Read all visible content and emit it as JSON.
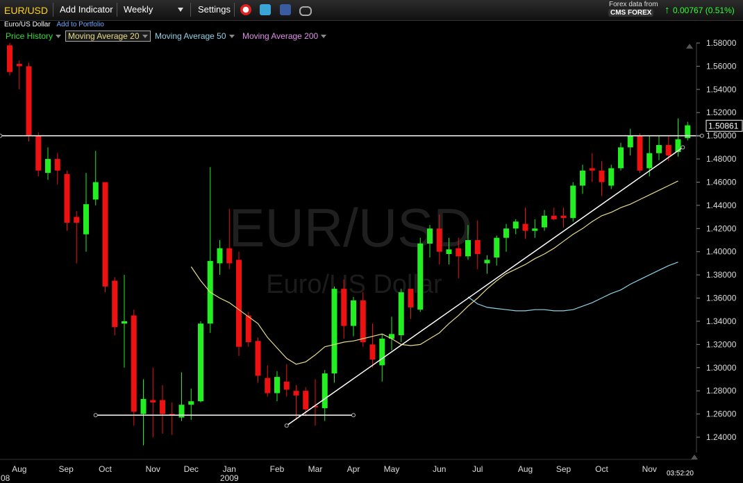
{
  "toolbar": {
    "symbol": "EUR/USD",
    "add_indicator": "Add Indicator",
    "interval": "Weekly",
    "settings": "Settings",
    "alarm_icon": "alarm-clock-icon",
    "twitter_icon": "twitter-icon",
    "facebook_icon": "facebook-icon",
    "link_icon": "link-icon"
  },
  "subheader": {
    "name": "Euro/US Dollar",
    "add_portfolio": "Add to Portfolio"
  },
  "indicators": [
    {
      "label": "Price History",
      "color": "#33dd33"
    },
    {
      "label": "Moving Average 20",
      "color": "#e8dc8a"
    },
    {
      "label": "Moving Average 50",
      "color": "#8fd3e8"
    },
    {
      "label": "Moving Average 200",
      "color": "#e090e8"
    }
  ],
  "data_source": {
    "line1": "Forex data from",
    "line2": "CMS FOREX"
  },
  "change": {
    "text": "0.00767 (0.51%)",
    "color": "#33ff33"
  },
  "timestamp": "03:52:20",
  "chart_data": {
    "type": "candlestick",
    "title": "EUR/USD",
    "subtitle": "Euro/US Dollar",
    "colors": {
      "up": "#22ee22",
      "down": "#ee1111",
      "ma20": "#e8dc8a",
      "ma50": "#8fd3e8",
      "trend": "#ffffff"
    },
    "ylim": [
      1.225,
      1.59
    ],
    "yticks": [
      "1.58000",
      "1.56000",
      "1.54000",
      "1.52000",
      "1.50000",
      "1.48000",
      "1.46000",
      "1.44000",
      "1.42000",
      "1.40000",
      "1.38000",
      "1.36000",
      "1.34000",
      "1.32000",
      "1.30000",
      "1.28000",
      "1.26000",
      "1.24000"
    ],
    "ytick_values": [
      1.58,
      1.56,
      1.54,
      1.52,
      1.5,
      1.48,
      1.46,
      1.44,
      1.42,
      1.4,
      1.38,
      1.36,
      1.34,
      1.32,
      1.3,
      1.28,
      1.26,
      1.24
    ],
    "last_price": "1.50861",
    "last_value": 1.50861,
    "xlabels": [
      {
        "text": "Aug",
        "week": 1
      },
      {
        "text": "Sep",
        "week": 5.9
      },
      {
        "text": "Oct",
        "week": 10
      },
      {
        "text": "Nov",
        "week": 15
      },
      {
        "text": "Dec",
        "week": 19
      },
      {
        "text": "Jan",
        "week": 23
      },
      {
        "text": "Feb",
        "week": 28
      },
      {
        "text": "Mar",
        "week": 32
      },
      {
        "text": "Apr",
        "week": 36
      },
      {
        "text": "May",
        "week": 40
      },
      {
        "text": "Jun",
        "week": 45
      },
      {
        "text": "Jul",
        "week": 49
      },
      {
        "text": "Aug",
        "week": 54
      },
      {
        "text": "Sep",
        "week": 58
      },
      {
        "text": "Oct",
        "week": 62
      },
      {
        "text": "Nov",
        "week": 67
      }
    ],
    "xlabels_year": [
      {
        "text": "08",
        "week": 0
      },
      {
        "text": "2009",
        "week": 23
      }
    ],
    "candles": [
      {
        "o": 1.578,
        "h": 1.58,
        "l": 1.552,
        "c": 1.555
      },
      {
        "o": 1.562,
        "h": 1.565,
        "l": 1.54,
        "c": 1.56
      },
      {
        "o": 1.56,
        "h": 1.563,
        "l": 1.495,
        "c": 1.5
      },
      {
        "o": 1.5,
        "h": 1.503,
        "l": 1.465,
        "c": 1.47
      },
      {
        "o": 1.468,
        "h": 1.49,
        "l": 1.462,
        "c": 1.48
      },
      {
        "o": 1.48,
        "h": 1.485,
        "l": 1.458,
        "c": 1.47
      },
      {
        "o": 1.467,
        "h": 1.47,
        "l": 1.418,
        "c": 1.425
      },
      {
        "o": 1.43,
        "h": 1.435,
        "l": 1.39,
        "c": 1.425
      },
      {
        "o": 1.415,
        "h": 1.468,
        "l": 1.4,
        "c": 1.441
      },
      {
        "o": 1.445,
        "h": 1.487,
        "l": 1.44,
        "c": 1.46
      },
      {
        "o": 1.46,
        "h": 1.46,
        "l": 1.365,
        "c": 1.37
      },
      {
        "o": 1.375,
        "h": 1.378,
        "l": 1.328,
        "c": 1.335
      },
      {
        "o": 1.338,
        "h": 1.38,
        "l": 1.3,
        "c": 1.34
      },
      {
        "o": 1.345,
        "h": 1.35,
        "l": 1.25,
        "c": 1.262
      },
      {
        "o": 1.26,
        "h": 1.29,
        "l": 1.233,
        "c": 1.273
      },
      {
        "o": 1.272,
        "h": 1.3,
        "l": 1.24,
        "c": 1.27
      },
      {
        "o": 1.272,
        "h": 1.285,
        "l": 1.243,
        "c": 1.26
      },
      {
        "o": 1.26,
        "h": 1.27,
        "l": 1.242,
        "c": 1.259
      },
      {
        "o": 1.257,
        "h": 1.296,
        "l": 1.254,
        "c": 1.268
      },
      {
        "o": 1.268,
        "h": 1.282,
        "l": 1.255,
        "c": 1.271
      },
      {
        "o": 1.271,
        "h": 1.34,
        "l": 1.27,
        "c": 1.338
      },
      {
        "o": 1.338,
        "h": 1.473,
        "l": 1.33,
        "c": 1.392
      },
      {
        "o": 1.39,
        "h": 1.41,
        "l": 1.38,
        "c": 1.403
      },
      {
        "o": 1.403,
        "h": 1.437,
        "l": 1.385,
        "c": 1.39
      },
      {
        "o": 1.393,
        "h": 1.4,
        "l": 1.31,
        "c": 1.318
      },
      {
        "o": 1.345,
        "h": 1.348,
        "l": 1.318,
        "c": 1.322
      },
      {
        "o": 1.323,
        "h": 1.326,
        "l": 1.287,
        "c": 1.293
      },
      {
        "o": 1.291,
        "h": 1.302,
        "l": 1.275,
        "c": 1.278
      },
      {
        "o": 1.278,
        "h": 1.297,
        "l": 1.271,
        "c": 1.292
      },
      {
        "o": 1.288,
        "h": 1.303,
        "l": 1.275,
        "c": 1.281
      },
      {
        "o": 1.28,
        "h": 1.285,
        "l": 1.255,
        "c": 1.276
      },
      {
        "o": 1.28,
        "h": 1.283,
        "l": 1.258,
        "c": 1.264
      },
      {
        "o": 1.267,
        "h": 1.29,
        "l": 1.25,
        "c": 1.266
      },
      {
        "o": 1.265,
        "h": 1.298,
        "l": 1.254,
        "c": 1.295
      },
      {
        "o": 1.295,
        "h": 1.37,
        "l": 1.287,
        "c": 1.368
      },
      {
        "o": 1.368,
        "h": 1.376,
        "l": 1.325,
        "c": 1.336
      },
      {
        "o": 1.336,
        "h": 1.361,
        "l": 1.327,
        "c": 1.358
      },
      {
        "o": 1.358,
        "h": 1.365,
        "l": 1.318,
        "c": 1.322
      },
      {
        "o": 1.32,
        "h": 1.338,
        "l": 1.3,
        "c": 1.307
      },
      {
        "o": 1.302,
        "h": 1.329,
        "l": 1.288,
        "c": 1.325
      },
      {
        "o": 1.325,
        "h": 1.344,
        "l": 1.315,
        "c": 1.329
      },
      {
        "o": 1.328,
        "h": 1.368,
        "l": 1.322,
        "c": 1.365
      },
      {
        "o": 1.368,
        "h": 1.365,
        "l": 1.342,
        "c": 1.352
      },
      {
        "o": 1.35,
        "h": 1.412,
        "l": 1.348,
        "c": 1.407
      },
      {
        "o": 1.407,
        "h": 1.423,
        "l": 1.395,
        "c": 1.42
      },
      {
        "o": 1.42,
        "h": 1.432,
        "l": 1.389,
        "c": 1.4
      },
      {
        "o": 1.398,
        "h": 1.412,
        "l": 1.389,
        "c": 1.402
      },
      {
        "o": 1.403,
        "h": 1.412,
        "l": 1.377,
        "c": 1.396
      },
      {
        "o": 1.396,
        "h": 1.423,
        "l": 1.393,
        "c": 1.41
      },
      {
        "o": 1.41,
        "h": 1.427,
        "l": 1.385,
        "c": 1.398
      },
      {
        "o": 1.39,
        "h": 1.397,
        "l": 1.381,
        "c": 1.393
      },
      {
        "o": 1.395,
        "h": 1.414,
        "l": 1.388,
        "c": 1.412
      },
      {
        "o": 1.412,
        "h": 1.424,
        "l": 1.4,
        "c": 1.42
      },
      {
        "o": 1.42,
        "h": 1.428,
        "l": 1.415,
        "c": 1.426
      },
      {
        "o": 1.424,
        "h": 1.438,
        "l": 1.411,
        "c": 1.418
      },
      {
        "o": 1.418,
        "h": 1.428,
        "l": 1.412,
        "c": 1.42
      },
      {
        "o": 1.421,
        "h": 1.436,
        "l": 1.418,
        "c": 1.431
      },
      {
        "o": 1.431,
        "h": 1.438,
        "l": 1.427,
        "c": 1.428
      },
      {
        "o": 1.431,
        "h": 1.438,
        "l": 1.421,
        "c": 1.429
      },
      {
        "o": 1.429,
        "h": 1.46,
        "l": 1.426,
        "c": 1.457
      },
      {
        "o": 1.457,
        "h": 1.475,
        "l": 1.45,
        "c": 1.47
      },
      {
        "o": 1.472,
        "h": 1.485,
        "l": 1.46,
        "c": 1.47
      },
      {
        "o": 1.47,
        "h": 1.478,
        "l": 1.448,
        "c": 1.46
      },
      {
        "o": 1.457,
        "h": 1.475,
        "l": 1.454,
        "c": 1.472
      },
      {
        "o": 1.472,
        "h": 1.494,
        "l": 1.47,
        "c": 1.49
      },
      {
        "o": 1.49,
        "h": 1.506,
        "l": 1.483,
        "c": 1.5
      },
      {
        "o": 1.5,
        "h": 1.502,
        "l": 1.468,
        "c": 1.47
      },
      {
        "o": 1.472,
        "h": 1.5,
        "l": 1.465,
        "c": 1.485
      },
      {
        "o": 1.485,
        "h": 1.5,
        "l": 1.479,
        "c": 1.492
      },
      {
        "o": 1.492,
        "h": 1.5,
        "l": 1.478,
        "c": 1.483
      },
      {
        "o": 1.486,
        "h": 1.515,
        "l": 1.482,
        "c": 1.497
      },
      {
        "o": 1.498,
        "h": 1.512,
        "l": 1.496,
        "c": 1.509
      }
    ],
    "ma20": [
      {
        "week": 19,
        "y": 1.387
      },
      {
        "week": 20,
        "y": 1.375
      },
      {
        "week": 21,
        "y": 1.365
      },
      {
        "week": 22,
        "y": 1.36
      },
      {
        "week": 23,
        "y": 1.356
      },
      {
        "week": 24,
        "y": 1.35
      },
      {
        "week": 25,
        "y": 1.344
      },
      {
        "week": 26,
        "y": 1.338
      },
      {
        "week": 27,
        "y": 1.326
      },
      {
        "week": 28,
        "y": 1.317
      },
      {
        "week": 29,
        "y": 1.308
      },
      {
        "week": 30,
        "y": 1.303
      },
      {
        "week": 31,
        "y": 1.305
      },
      {
        "week": 32,
        "y": 1.311
      },
      {
        "week": 33,
        "y": 1.318
      },
      {
        "week": 34,
        "y": 1.32
      },
      {
        "week": 35,
        "y": 1.322
      },
      {
        "week": 36,
        "y": 1.323
      },
      {
        "week": 37,
        "y": 1.325
      },
      {
        "week": 38,
        "y": 1.327
      },
      {
        "week": 39,
        "y": 1.329
      },
      {
        "week": 40,
        "y": 1.325
      },
      {
        "week": 41,
        "y": 1.32
      },
      {
        "week": 42,
        "y": 1.319
      },
      {
        "week": 43,
        "y": 1.32
      },
      {
        "week": 44,
        "y": 1.325
      },
      {
        "week": 45,
        "y": 1.33
      },
      {
        "week": 46,
        "y": 1.338
      },
      {
        "week": 47,
        "y": 1.345
      },
      {
        "week": 48,
        "y": 1.353
      },
      {
        "week": 49,
        "y": 1.36
      },
      {
        "week": 50,
        "y": 1.368
      },
      {
        "week": 51,
        "y": 1.375
      },
      {
        "week": 52,
        "y": 1.381
      },
      {
        "week": 53,
        "y": 1.385
      },
      {
        "week": 54,
        "y": 1.389
      },
      {
        "week": 55,
        "y": 1.394
      },
      {
        "week": 56,
        "y": 1.398
      },
      {
        "week": 57,
        "y": 1.403
      },
      {
        "week": 58,
        "y": 1.409
      },
      {
        "week": 59,
        "y": 1.415
      },
      {
        "week": 60,
        "y": 1.42
      },
      {
        "week": 61,
        "y": 1.426
      },
      {
        "week": 62,
        "y": 1.431
      },
      {
        "week": 63,
        "y": 1.434
      },
      {
        "week": 64,
        "y": 1.438
      },
      {
        "week": 65,
        "y": 1.441
      },
      {
        "week": 66,
        "y": 1.445
      },
      {
        "week": 67,
        "y": 1.449
      },
      {
        "week": 68,
        "y": 1.453
      },
      {
        "week": 69,
        "y": 1.457
      },
      {
        "week": 70,
        "y": 1.461
      }
    ],
    "ma50": [
      {
        "week": 48,
        "y": 1.361
      },
      {
        "week": 49,
        "y": 1.355
      },
      {
        "week": 50,
        "y": 1.352
      },
      {
        "week": 51,
        "y": 1.351
      },
      {
        "week": 52,
        "y": 1.35
      },
      {
        "week": 53,
        "y": 1.349
      },
      {
        "week": 54,
        "y": 1.349
      },
      {
        "week": 55,
        "y": 1.35
      },
      {
        "week": 56,
        "y": 1.35
      },
      {
        "week": 57,
        "y": 1.349
      },
      {
        "week": 58,
        "y": 1.349
      },
      {
        "week": 59,
        "y": 1.35
      },
      {
        "week": 60,
        "y": 1.353
      },
      {
        "week": 61,
        "y": 1.356
      },
      {
        "week": 62,
        "y": 1.36
      },
      {
        "week": 63,
        "y": 1.364
      },
      {
        "week": 64,
        "y": 1.367
      },
      {
        "week": 65,
        "y": 1.372
      },
      {
        "week": 66,
        "y": 1.376
      },
      {
        "week": 67,
        "y": 1.38
      },
      {
        "week": 68,
        "y": 1.384
      },
      {
        "week": 69,
        "y": 1.388
      },
      {
        "week": 70,
        "y": 1.391
      }
    ],
    "trendlines": [
      {
        "x1": -1,
        "y1": 1.5,
        "x2": 72.5,
        "y2": 1.5
      },
      {
        "x1": 9,
        "y1": 1.259,
        "x2": 36,
        "y2": 1.259
      },
      {
        "x1": 29,
        "y1": 1.25,
        "x2": 70.5,
        "y2": 1.49
      }
    ]
  }
}
